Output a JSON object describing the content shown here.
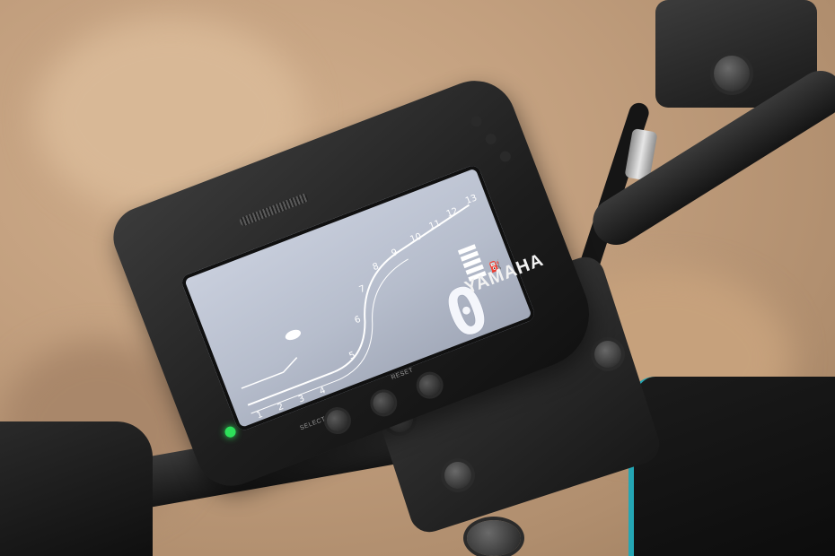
{
  "brand": "YAMAHA",
  "gear_display": "0",
  "rpm_ticks": [
    "1",
    "2",
    "3",
    "4",
    "5",
    "6",
    "7",
    "8",
    "9",
    "10",
    "11",
    "12",
    "13"
  ],
  "buttons": {
    "select": "SELECT",
    "reset": "RESET"
  },
  "indicator_colors": {
    "neutral_led": "#2ee05a",
    "screen_backlight": "#bfc6d6"
  },
  "fuel_level_segments": 5
}
